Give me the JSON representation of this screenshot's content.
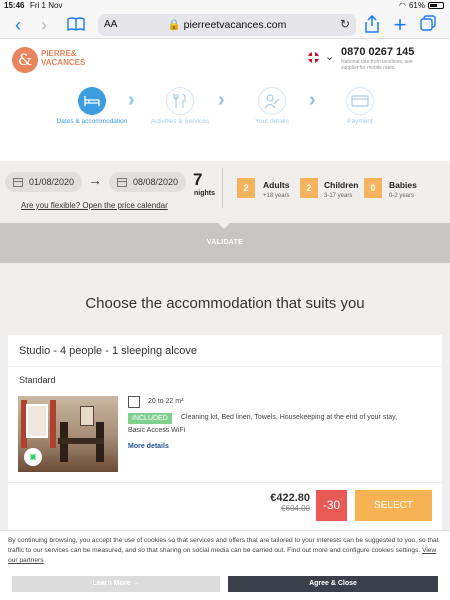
{
  "status_bar": {
    "time": "15:46",
    "date": "Fri 1 Nov",
    "battery": "61%"
  },
  "browser": {
    "text_size_label": "AA",
    "url": "pierreetvacances.com"
  },
  "site": {
    "logo_letter": "&",
    "logo_text_line1": "PIERRE&",
    "logo_text_line2": "VACANCES",
    "phone": "0870 0267 145",
    "phone_note": "National rate from landlines, see supplier for mobile rates."
  },
  "steps": [
    {
      "label": "Dates & accommodation",
      "state": "active",
      "icon": "bed-icon"
    },
    {
      "label": "Activities & Services",
      "state": "inactive",
      "icon": "cutlery-icon"
    },
    {
      "label": "Your details",
      "state": "inactive",
      "icon": "person-edit-icon"
    },
    {
      "label": "Payment",
      "state": "inactive",
      "icon": "card-icon"
    }
  ],
  "booking": {
    "start_date": "01/08/2020",
    "end_date": "08/08/2020",
    "nights_count": "7",
    "nights_label": "nights",
    "flexible_link": "Are you flexible? Open the price calendar",
    "adults": {
      "count": "2",
      "label": "Adults",
      "ages": "+18 years"
    },
    "children": {
      "count": "2",
      "label": "Children",
      "ages": "3-17 years"
    },
    "babies": {
      "count": "0",
      "label": "Babies",
      "ages": "0-2 years"
    },
    "validate_label": "VALIDATE"
  },
  "heading": "Choose the accommodation that suits you",
  "offer": {
    "title": "Studio - 4 people - 1 sleeping alcove",
    "category": "Standard",
    "size": "20 to 22 m²",
    "included_badge": "INCLUDED",
    "included_items_line1": "Cleaning kit, Bed linen, Towels, Housekeeping at the end of your stay,",
    "included_items_line2": "Basic Access WiFi",
    "more_details": "More details",
    "price": "€422.80",
    "old_price": "€604.00",
    "discount": "-30 %",
    "select_label": "SELECT"
  },
  "cookie": {
    "text": "By continuing browsing, you accept the use of cookies so that services and offers that are tailored to your interests can be suggested to you, so that traffic to our services can be measured, and so that sharing on social media can be carried out. Find out more and configure cookies settings.",
    "link": "View our partners",
    "learn_more": "Learn More →",
    "agree": "Agree & Close"
  },
  "colors": {
    "accent_blue": "#3c9de0",
    "brand_orange": "#e8855f",
    "pax_orange": "#f5b35b",
    "select_orange": "#f7b253",
    "discount_red": "#e95a57",
    "included_green": "#7fcf8f"
  }
}
